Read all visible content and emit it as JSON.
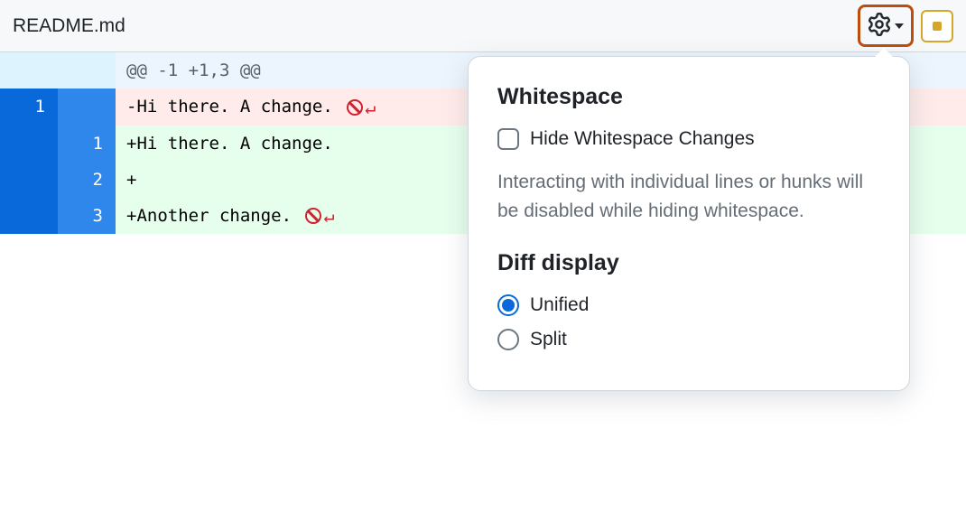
{
  "header": {
    "file_name": "README.md"
  },
  "diff": {
    "hunk_header": "@@ -1 +1,3 @@",
    "lines": [
      {
        "old_num": "1",
        "new_num": "",
        "prefix": "-",
        "text": "Hi there. A change. ",
        "markers": true,
        "type": "deletion"
      },
      {
        "old_num": "",
        "new_num": "1",
        "prefix": "+",
        "text": "Hi there. A change.",
        "markers": false,
        "type": "addition"
      },
      {
        "old_num": "",
        "new_num": "2",
        "prefix": "+",
        "text": "",
        "markers": false,
        "type": "addition"
      },
      {
        "old_num": "",
        "new_num": "3",
        "prefix": "+",
        "text": "Another change. ",
        "markers": true,
        "type": "addition"
      }
    ]
  },
  "dropdown": {
    "whitespace_heading": "Whitespace",
    "hide_whitespace_label": "Hide Whitespace Changes",
    "whitespace_description": "Interacting with individual lines or hunks will be disabled while hiding whitespace.",
    "diff_display_heading": "Diff display",
    "unified_label": "Unified",
    "split_label": "Split",
    "diff_display_selected": "unified"
  }
}
